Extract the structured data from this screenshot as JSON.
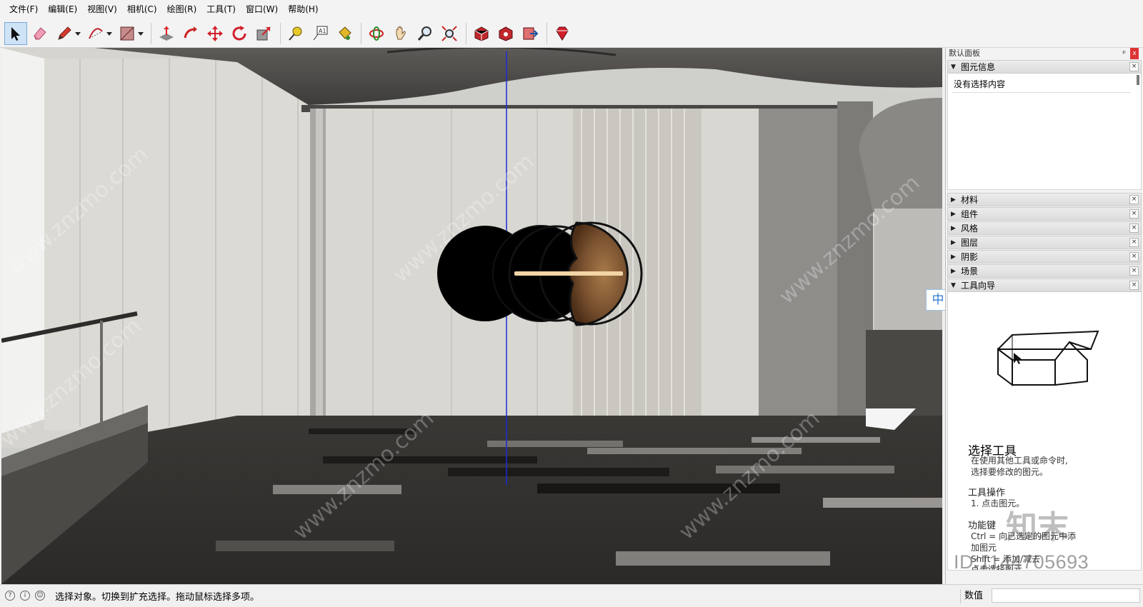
{
  "menu": [
    "文件(F)",
    "编辑(E)",
    "视图(V)",
    "相机(C)",
    "绘图(R)",
    "工具(T)",
    "窗口(W)",
    "帮助(H)"
  ],
  "toolbar": {
    "tools": [
      {
        "name": "select",
        "active": true
      },
      {
        "name": "eraser"
      },
      {
        "name": "pencil",
        "dropdown": true
      },
      {
        "name": "arc",
        "dropdown": true
      },
      {
        "name": "rectangle",
        "dropdown": true
      },
      {
        "name": "push-pull"
      },
      {
        "name": "follow-me"
      },
      {
        "name": "move"
      },
      {
        "name": "rotate"
      },
      {
        "name": "scale"
      },
      {
        "name": "tape-measure"
      },
      {
        "name": "text"
      },
      {
        "name": "paint-bucket"
      },
      {
        "name": "orbit"
      },
      {
        "name": "pan"
      },
      {
        "name": "zoom"
      },
      {
        "name": "zoom-extents"
      },
      {
        "name": "warehouse"
      },
      {
        "name": "extension-warehouse"
      },
      {
        "name": "send-to-layout"
      },
      {
        "name": "ruby-console"
      }
    ]
  },
  "panel": {
    "title": "默认面板",
    "entity_info": {
      "label": "图元信息",
      "empty_text": "没有选择内容"
    },
    "collapsed_sections": [
      "材料",
      "组件",
      "风格",
      "图层",
      "阴影",
      "场景"
    ],
    "instructor": {
      "label": "工具向导",
      "title": "选择工具",
      "desc_1": "在使用其他工具或命令时,",
      "desc_2": "选择要修改的图元。",
      "ops_head": "工具操作",
      "op_1": "1. 点击图元。",
      "func_head": "功能键",
      "func_1": "Ctrl = 向已选定的图元中添",
      "func_2": "加图元",
      "func_3": "Shift = 添加/减去",
      "func_4": "点击选择图元"
    }
  },
  "ime_indicator": "中",
  "watermark": {
    "site": "www.znzmo.com",
    "brand": "知末网",
    "logo": "知末",
    "id": "ID:1144705693"
  },
  "status": {
    "text": "选择对象。切换到扩充选择。拖动鼠标选择多项。",
    "measure_label": "数值",
    "measure_value": ""
  }
}
